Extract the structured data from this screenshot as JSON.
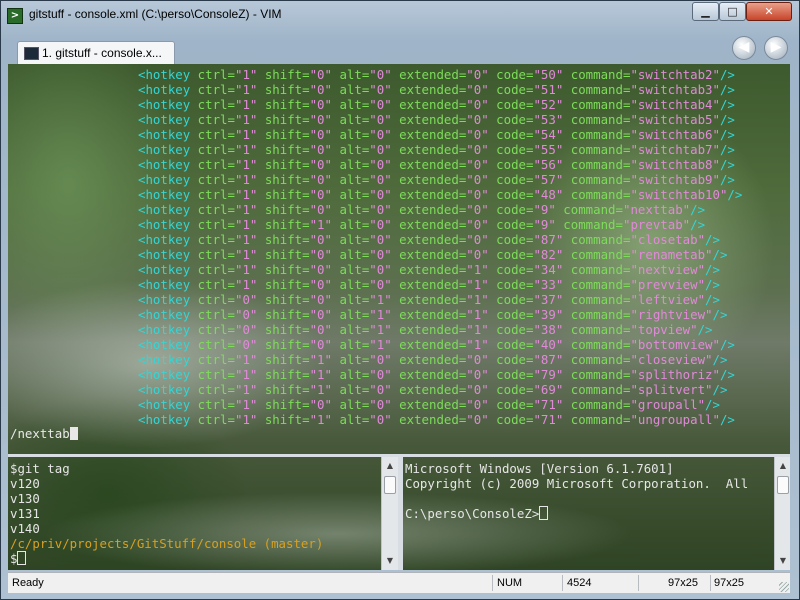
{
  "window": {
    "title": "gitstuff - console.xml (C:\\perso\\ConsoleZ) - VIM",
    "minimize_label": "▁",
    "maximize_label": "□",
    "close_label": "✕"
  },
  "tabs": [
    {
      "label": "1. gitstuff - console.x..."
    }
  ],
  "nav": {
    "back_icon": "◀",
    "forward_icon": "▶"
  },
  "vim_pane": {
    "lines": [
      {
        "tag": "<hotkey",
        "ctrl": "\"1\"",
        "shift": "\"0\"",
        "alt": "\"0\"",
        "extended": "\"0\"",
        "code": "\"50\"",
        "command": "\"switchtab2\"",
        "close": "/>"
      },
      {
        "tag": "<hotkey",
        "ctrl": "\"1\"",
        "shift": "\"0\"",
        "alt": "\"0\"",
        "extended": "\"0\"",
        "code": "\"51\"",
        "command": "\"switchtab3\"",
        "close": "/>"
      },
      {
        "tag": "<hotkey",
        "ctrl": "\"1\"",
        "shift": "\"0\"",
        "alt": "\"0\"",
        "extended": "\"0\"",
        "code": "\"52\"",
        "command": "\"switchtab4\"",
        "close": "/>"
      },
      {
        "tag": "<hotkey",
        "ctrl": "\"1\"",
        "shift": "\"0\"",
        "alt": "\"0\"",
        "extended": "\"0\"",
        "code": "\"53\"",
        "command": "\"switchtab5\"",
        "close": "/>"
      },
      {
        "tag": "<hotkey",
        "ctrl": "\"1\"",
        "shift": "\"0\"",
        "alt": "\"0\"",
        "extended": "\"0\"",
        "code": "\"54\"",
        "command": "\"switchtab6\"",
        "close": "/>"
      },
      {
        "tag": "<hotkey",
        "ctrl": "\"1\"",
        "shift": "\"0\"",
        "alt": "\"0\"",
        "extended": "\"0\"",
        "code": "\"55\"",
        "command": "\"switchtab7\"",
        "close": "/>"
      },
      {
        "tag": "<hotkey",
        "ctrl": "\"1\"",
        "shift": "\"0\"",
        "alt": "\"0\"",
        "extended": "\"0\"",
        "code": "\"56\"",
        "command": "\"switchtab8\"",
        "close": "/>"
      },
      {
        "tag": "<hotkey",
        "ctrl": "\"1\"",
        "shift": "\"0\"",
        "alt": "\"0\"",
        "extended": "\"0\"",
        "code": "\"57\"",
        "command": "\"switchtab9\"",
        "close": "/>"
      },
      {
        "tag": "<hotkey",
        "ctrl": "\"1\"",
        "shift": "\"0\"",
        "alt": "\"0\"",
        "extended": "\"0\"",
        "code": "\"48\"",
        "command": "\"switchtab10\"",
        "close": "/>"
      },
      {
        "tag": "<hotkey",
        "ctrl": "\"1\"",
        "shift": "\"0\"",
        "alt": "\"0\"",
        "extended": "\"0\"",
        "code": "\"9\"",
        "command": "\"nexttab\"",
        "close": "/>"
      },
      {
        "tag": "<hotkey",
        "ctrl": "\"1\"",
        "shift": "\"1\"",
        "alt": "\"0\"",
        "extended": "\"0\"",
        "code": "\"9\"",
        "command": "\"prevtab\"",
        "close": "/>"
      },
      {
        "tag": "<hotkey",
        "ctrl": "\"1\"",
        "shift": "\"0\"",
        "alt": "\"0\"",
        "extended": "\"0\"",
        "code": "\"87\"",
        "command": "\"closetab\"",
        "close": "/>"
      },
      {
        "tag": "<hotkey",
        "ctrl": "\"1\"",
        "shift": "\"0\"",
        "alt": "\"0\"",
        "extended": "\"0\"",
        "code": "\"82\"",
        "command": "\"renametab\"",
        "close": "/>"
      },
      {
        "tag": "<hotkey",
        "ctrl": "\"1\"",
        "shift": "\"0\"",
        "alt": "\"0\"",
        "extended": "\"1\"",
        "code": "\"34\"",
        "command": "\"nextview\"",
        "close": "/>"
      },
      {
        "tag": "<hotkey",
        "ctrl": "\"1\"",
        "shift": "\"0\"",
        "alt": "\"0\"",
        "extended": "\"1\"",
        "code": "\"33\"",
        "command": "\"prevview\"",
        "close": "/>"
      },
      {
        "tag": "<hotkey",
        "ctrl": "\"0\"",
        "shift": "\"0\"",
        "alt": "\"1\"",
        "extended": "\"1\"",
        "code": "\"37\"",
        "command": "\"leftview\"",
        "close": "/>"
      },
      {
        "tag": "<hotkey",
        "ctrl": "\"0\"",
        "shift": "\"0\"",
        "alt": "\"1\"",
        "extended": "\"1\"",
        "code": "\"39\"",
        "command": "\"rightview\"",
        "close": "/>"
      },
      {
        "tag": "<hotkey",
        "ctrl": "\"0\"",
        "shift": "\"0\"",
        "alt": "\"1\"",
        "extended": "\"1\"",
        "code": "\"38\"",
        "command": "\"topview\"",
        "close": "/>"
      },
      {
        "tag": "<hotkey",
        "ctrl": "\"0\"",
        "shift": "\"0\"",
        "alt": "\"1\"",
        "extended": "\"1\"",
        "code": "\"40\"",
        "command": "\"bottomview\"",
        "close": "/>"
      },
      {
        "tag": "<hotkey",
        "ctrl": "\"1\"",
        "shift": "\"1\"",
        "alt": "\"0\"",
        "extended": "\"0\"",
        "code": "\"87\"",
        "command": "\"closeview\"",
        "close": "/>"
      },
      {
        "tag": "<hotkey",
        "ctrl": "\"1\"",
        "shift": "\"1\"",
        "alt": "\"0\"",
        "extended": "\"0\"",
        "code": "\"79\"",
        "command": "\"splithoriz\"",
        "close": "/>"
      },
      {
        "tag": "<hotkey",
        "ctrl": "\"1\"",
        "shift": "\"1\"",
        "alt": "\"0\"",
        "extended": "\"0\"",
        "code": "\"69\"",
        "command": "\"splitvert\"",
        "close": "/>"
      },
      {
        "tag": "<hotkey",
        "ctrl": "\"1\"",
        "shift": "\"0\"",
        "alt": "\"0\"",
        "extended": "\"0\"",
        "code": "\"71\"",
        "command": "\"groupall\"",
        "close": "/>"
      },
      {
        "tag": "<hotkey",
        "ctrl": "\"1\"",
        "shift": "\"1\"",
        "alt": "\"0\"",
        "extended": "\"0\"",
        "code": "\"71\"",
        "command": "\"ungroupall\"",
        "close": "/>"
      }
    ],
    "command_line": "/nexttab"
  },
  "git_pane": {
    "lines": [
      "$git tag",
      "v120",
      "v130",
      "v131",
      "v140"
    ],
    "path_line": "/c/priv/projects/GitStuff/console (master)",
    "prompt": "$"
  },
  "cmd_pane": {
    "lines": [
      "Microsoft Windows [Version 6.1.7601]",
      "Copyright (c) 2009 Microsoft Corporation.  All",
      "",
      "C:\\perso\\ConsoleZ>"
    ]
  },
  "status": {
    "ready": "Ready",
    "num": "NUM",
    "pid": "4524",
    "size1": "97x25",
    "size2": "97x25"
  },
  "colors": {
    "tag": "#33d6d6",
    "attribute": "#7ddc5a",
    "value": "#e08ad8",
    "git_path": "#d8a020"
  }
}
